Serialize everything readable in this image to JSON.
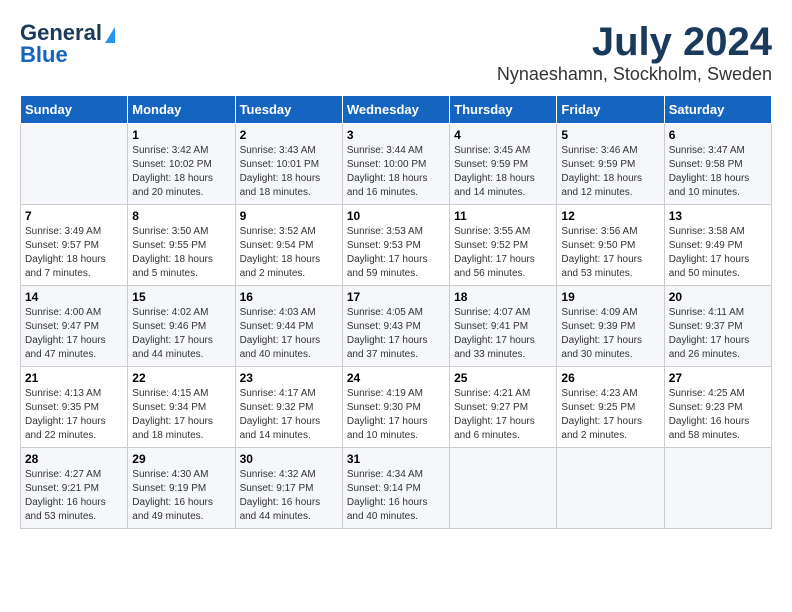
{
  "header": {
    "logo_line1": "General",
    "logo_line2": "Blue",
    "month": "July 2024",
    "location": "Nynaeshamn, Stockholm, Sweden"
  },
  "weekdays": [
    "Sunday",
    "Monday",
    "Tuesday",
    "Wednesday",
    "Thursday",
    "Friday",
    "Saturday"
  ],
  "weeks": [
    [
      {
        "day": "",
        "info": ""
      },
      {
        "day": "1",
        "info": "Sunrise: 3:42 AM\nSunset: 10:02 PM\nDaylight: 18 hours\nand 20 minutes."
      },
      {
        "day": "2",
        "info": "Sunrise: 3:43 AM\nSunset: 10:01 PM\nDaylight: 18 hours\nand 18 minutes."
      },
      {
        "day": "3",
        "info": "Sunrise: 3:44 AM\nSunset: 10:00 PM\nDaylight: 18 hours\nand 16 minutes."
      },
      {
        "day": "4",
        "info": "Sunrise: 3:45 AM\nSunset: 9:59 PM\nDaylight: 18 hours\nand 14 minutes."
      },
      {
        "day": "5",
        "info": "Sunrise: 3:46 AM\nSunset: 9:59 PM\nDaylight: 18 hours\nand 12 minutes."
      },
      {
        "day": "6",
        "info": "Sunrise: 3:47 AM\nSunset: 9:58 PM\nDaylight: 18 hours\nand 10 minutes."
      }
    ],
    [
      {
        "day": "7",
        "info": "Sunrise: 3:49 AM\nSunset: 9:57 PM\nDaylight: 18 hours\nand 7 minutes."
      },
      {
        "day": "8",
        "info": "Sunrise: 3:50 AM\nSunset: 9:55 PM\nDaylight: 18 hours\nand 5 minutes."
      },
      {
        "day": "9",
        "info": "Sunrise: 3:52 AM\nSunset: 9:54 PM\nDaylight: 18 hours\nand 2 minutes."
      },
      {
        "day": "10",
        "info": "Sunrise: 3:53 AM\nSunset: 9:53 PM\nDaylight: 17 hours\nand 59 minutes."
      },
      {
        "day": "11",
        "info": "Sunrise: 3:55 AM\nSunset: 9:52 PM\nDaylight: 17 hours\nand 56 minutes."
      },
      {
        "day": "12",
        "info": "Sunrise: 3:56 AM\nSunset: 9:50 PM\nDaylight: 17 hours\nand 53 minutes."
      },
      {
        "day": "13",
        "info": "Sunrise: 3:58 AM\nSunset: 9:49 PM\nDaylight: 17 hours\nand 50 minutes."
      }
    ],
    [
      {
        "day": "14",
        "info": "Sunrise: 4:00 AM\nSunset: 9:47 PM\nDaylight: 17 hours\nand 47 minutes."
      },
      {
        "day": "15",
        "info": "Sunrise: 4:02 AM\nSunset: 9:46 PM\nDaylight: 17 hours\nand 44 minutes."
      },
      {
        "day": "16",
        "info": "Sunrise: 4:03 AM\nSunset: 9:44 PM\nDaylight: 17 hours\nand 40 minutes."
      },
      {
        "day": "17",
        "info": "Sunrise: 4:05 AM\nSunset: 9:43 PM\nDaylight: 17 hours\nand 37 minutes."
      },
      {
        "day": "18",
        "info": "Sunrise: 4:07 AM\nSunset: 9:41 PM\nDaylight: 17 hours\nand 33 minutes."
      },
      {
        "day": "19",
        "info": "Sunrise: 4:09 AM\nSunset: 9:39 PM\nDaylight: 17 hours\nand 30 minutes."
      },
      {
        "day": "20",
        "info": "Sunrise: 4:11 AM\nSunset: 9:37 PM\nDaylight: 17 hours\nand 26 minutes."
      }
    ],
    [
      {
        "day": "21",
        "info": "Sunrise: 4:13 AM\nSunset: 9:35 PM\nDaylight: 17 hours\nand 22 minutes."
      },
      {
        "day": "22",
        "info": "Sunrise: 4:15 AM\nSunset: 9:34 PM\nDaylight: 17 hours\nand 18 minutes."
      },
      {
        "day": "23",
        "info": "Sunrise: 4:17 AM\nSunset: 9:32 PM\nDaylight: 17 hours\nand 14 minutes."
      },
      {
        "day": "24",
        "info": "Sunrise: 4:19 AM\nSunset: 9:30 PM\nDaylight: 17 hours\nand 10 minutes."
      },
      {
        "day": "25",
        "info": "Sunrise: 4:21 AM\nSunset: 9:27 PM\nDaylight: 17 hours\nand 6 minutes."
      },
      {
        "day": "26",
        "info": "Sunrise: 4:23 AM\nSunset: 9:25 PM\nDaylight: 17 hours\nand 2 minutes."
      },
      {
        "day": "27",
        "info": "Sunrise: 4:25 AM\nSunset: 9:23 PM\nDaylight: 16 hours\nand 58 minutes."
      }
    ],
    [
      {
        "day": "28",
        "info": "Sunrise: 4:27 AM\nSunset: 9:21 PM\nDaylight: 16 hours\nand 53 minutes."
      },
      {
        "day": "29",
        "info": "Sunrise: 4:30 AM\nSunset: 9:19 PM\nDaylight: 16 hours\nand 49 minutes."
      },
      {
        "day": "30",
        "info": "Sunrise: 4:32 AM\nSunset: 9:17 PM\nDaylight: 16 hours\nand 44 minutes."
      },
      {
        "day": "31",
        "info": "Sunrise: 4:34 AM\nSunset: 9:14 PM\nDaylight: 16 hours\nand 40 minutes."
      },
      {
        "day": "",
        "info": ""
      },
      {
        "day": "",
        "info": ""
      },
      {
        "day": "",
        "info": ""
      }
    ]
  ]
}
